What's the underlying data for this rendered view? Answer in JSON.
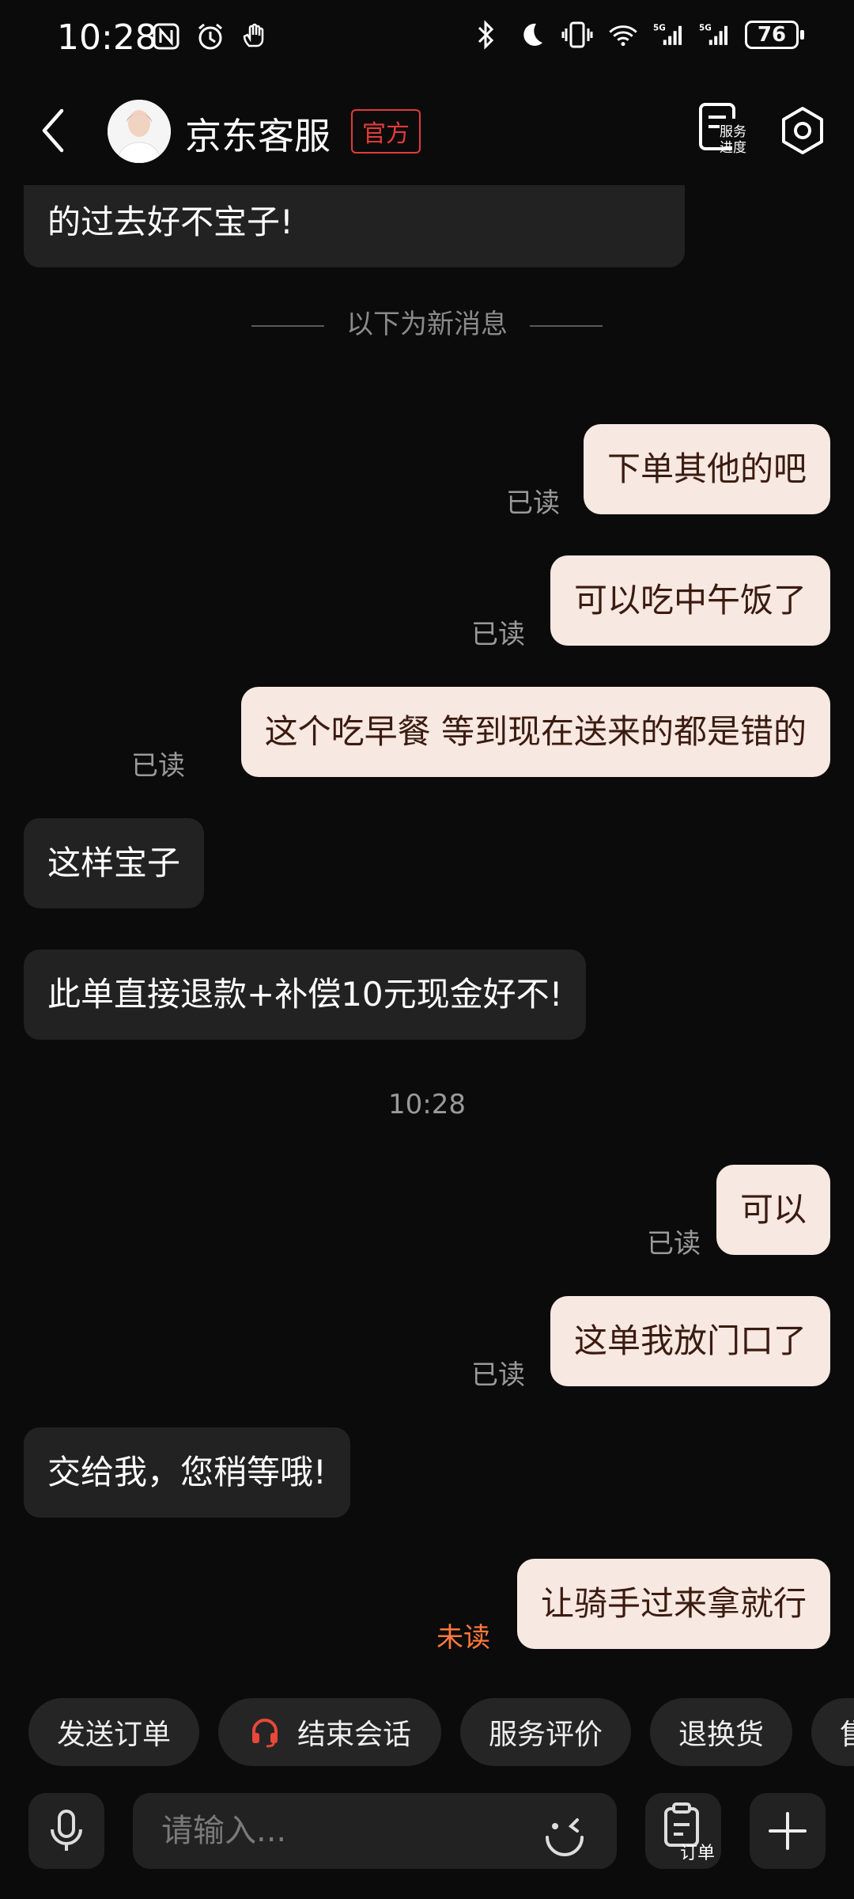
{
  "status_bar": {
    "time": "10:28",
    "battery": "76"
  },
  "header": {
    "title": "京东客服",
    "badge": "官方",
    "progress_label_line1": "服务",
    "progress_label_line2": "进度"
  },
  "chat": {
    "cut_message": "的过去好不宝子!",
    "new_divider": "以下为新消息",
    "timestamp": "10:28",
    "msg1": "下单其他的吧",
    "msg2": "可以吃中午饭了",
    "msg3": "这个吃早餐 等到现在送来的都是错的",
    "msg4": "这样宝子",
    "msg5": "此单直接退款+补偿10元现金好不!",
    "msg6": "可以",
    "msg7": "这单我放门口了",
    "msg8": "交给我，您稍等哦!",
    "msg9": "让骑手过来拿就行",
    "read": "已读",
    "unread": "未读"
  },
  "quick_replies": {
    "send_order": "发送订单",
    "end_session": "结束会话",
    "rate_service": "服务评价",
    "return_exchange": "退换货",
    "after_sale": "售"
  },
  "input": {
    "placeholder": "请输入...",
    "order_label": "订单"
  },
  "colors": {
    "accent_red": "#e23a3a",
    "unread_orange": "#ff7a3d",
    "out_bubble": "#f7e8e1",
    "in_bubble": "#222222"
  }
}
